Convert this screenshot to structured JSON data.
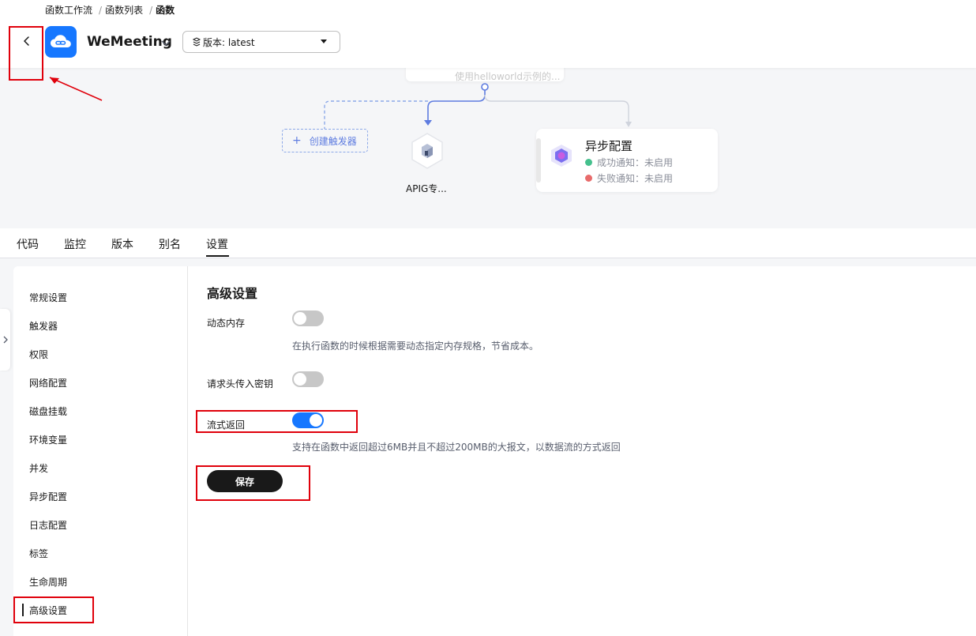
{
  "breadcrumb": {
    "items": [
      "函数工作流",
      "函数列表",
      "函数"
    ],
    "separator": "/"
  },
  "header": {
    "app_name": "WeMeeting",
    "version_label": "版本: latest"
  },
  "canvas": {
    "top_node_text": "使用helloworld示例的...",
    "add_trigger_label": "创建触发器",
    "apig_label": "APIG专...",
    "async": {
      "title": "异步配置",
      "success_label": "成功通知：未启用",
      "fail_label": "失败通知：未启用",
      "success_color": "#45c08d",
      "fail_color": "#e86b6b"
    }
  },
  "tabs": [
    "代码",
    "监控",
    "版本",
    "别名",
    "设置"
  ],
  "active_tab": "设置",
  "side_menu": {
    "items": [
      "常规设置",
      "触发器",
      "权限",
      "网络配置",
      "磁盘挂载",
      "环境变量",
      "并发",
      "异步配置",
      "日志配置",
      "标签",
      "生命周期",
      "高级设置"
    ],
    "active": "高级设置"
  },
  "panel": {
    "title": "高级设置",
    "fields": [
      {
        "label": "动态内存",
        "enabled": false,
        "hint": "在执行函数的时候根据需要动态指定内存规格，节省成本。"
      },
      {
        "label": "请求头传入密钥",
        "enabled": false,
        "hint": ""
      },
      {
        "label": "流式返回",
        "enabled": true,
        "hint": "支持在函数中返回超过6MB并且不超过200MB的大报文，以数据流的方式返回"
      }
    ],
    "save_label": "保存"
  },
  "colors": {
    "accent": "#1677ff",
    "annotation": "#e0000b",
    "flow_line": "#5e7ce0"
  }
}
